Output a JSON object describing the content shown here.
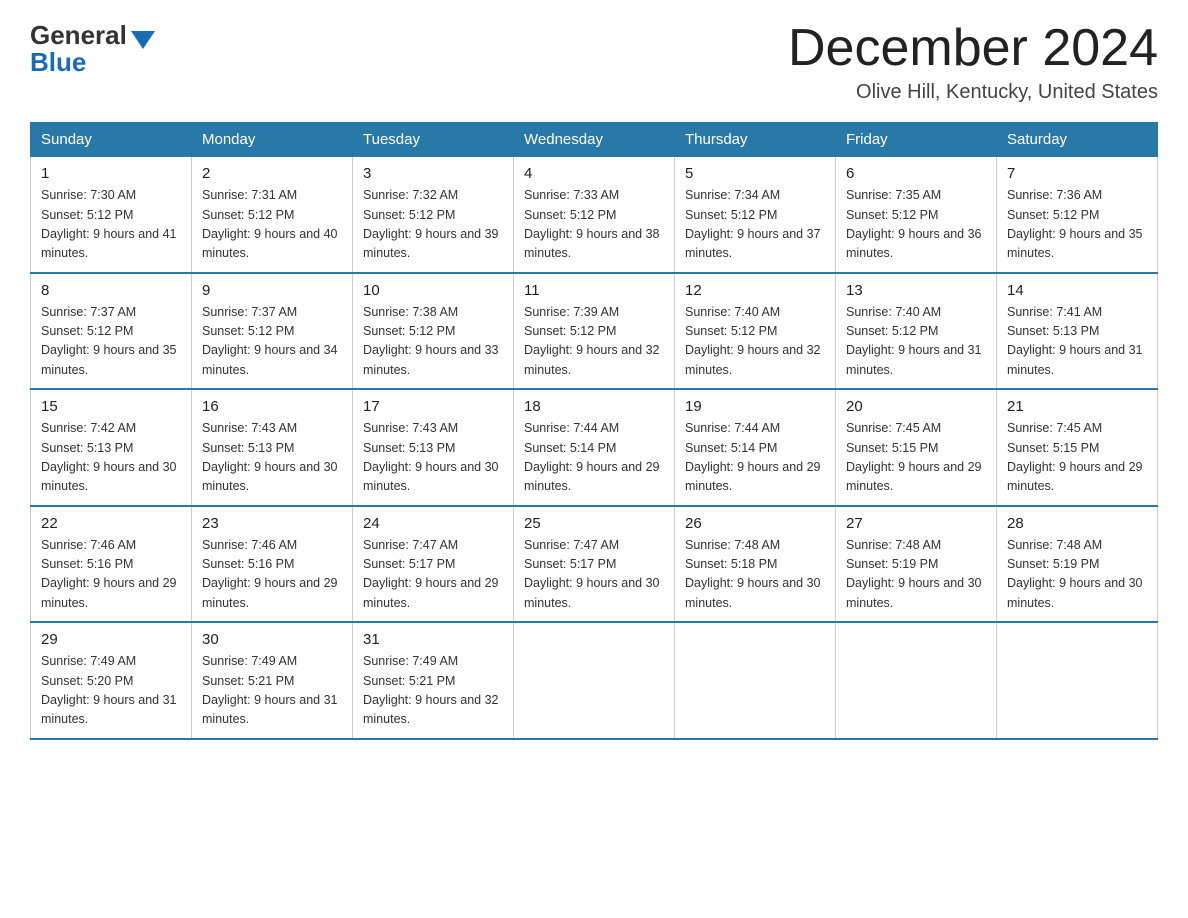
{
  "logo": {
    "general": "General",
    "blue": "Blue"
  },
  "title": "December 2024",
  "location": "Olive Hill, Kentucky, United States",
  "days_of_week": [
    "Sunday",
    "Monday",
    "Tuesday",
    "Wednesday",
    "Thursday",
    "Friday",
    "Saturday"
  ],
  "weeks": [
    [
      {
        "day": "1",
        "sunrise": "7:30 AM",
        "sunset": "5:12 PM",
        "daylight": "9 hours and 41 minutes."
      },
      {
        "day": "2",
        "sunrise": "7:31 AM",
        "sunset": "5:12 PM",
        "daylight": "9 hours and 40 minutes."
      },
      {
        "day": "3",
        "sunrise": "7:32 AM",
        "sunset": "5:12 PM",
        "daylight": "9 hours and 39 minutes."
      },
      {
        "day": "4",
        "sunrise": "7:33 AM",
        "sunset": "5:12 PM",
        "daylight": "9 hours and 38 minutes."
      },
      {
        "day": "5",
        "sunrise": "7:34 AM",
        "sunset": "5:12 PM",
        "daylight": "9 hours and 37 minutes."
      },
      {
        "day": "6",
        "sunrise": "7:35 AM",
        "sunset": "5:12 PM",
        "daylight": "9 hours and 36 minutes."
      },
      {
        "day": "7",
        "sunrise": "7:36 AM",
        "sunset": "5:12 PM",
        "daylight": "9 hours and 35 minutes."
      }
    ],
    [
      {
        "day": "8",
        "sunrise": "7:37 AM",
        "sunset": "5:12 PM",
        "daylight": "9 hours and 35 minutes."
      },
      {
        "day": "9",
        "sunrise": "7:37 AM",
        "sunset": "5:12 PM",
        "daylight": "9 hours and 34 minutes."
      },
      {
        "day": "10",
        "sunrise": "7:38 AM",
        "sunset": "5:12 PM",
        "daylight": "9 hours and 33 minutes."
      },
      {
        "day": "11",
        "sunrise": "7:39 AM",
        "sunset": "5:12 PM",
        "daylight": "9 hours and 32 minutes."
      },
      {
        "day": "12",
        "sunrise": "7:40 AM",
        "sunset": "5:12 PM",
        "daylight": "9 hours and 32 minutes."
      },
      {
        "day": "13",
        "sunrise": "7:40 AM",
        "sunset": "5:12 PM",
        "daylight": "9 hours and 31 minutes."
      },
      {
        "day": "14",
        "sunrise": "7:41 AM",
        "sunset": "5:13 PM",
        "daylight": "9 hours and 31 minutes."
      }
    ],
    [
      {
        "day": "15",
        "sunrise": "7:42 AM",
        "sunset": "5:13 PM",
        "daylight": "9 hours and 30 minutes."
      },
      {
        "day": "16",
        "sunrise": "7:43 AM",
        "sunset": "5:13 PM",
        "daylight": "9 hours and 30 minutes."
      },
      {
        "day": "17",
        "sunrise": "7:43 AM",
        "sunset": "5:13 PM",
        "daylight": "9 hours and 30 minutes."
      },
      {
        "day": "18",
        "sunrise": "7:44 AM",
        "sunset": "5:14 PM",
        "daylight": "9 hours and 29 minutes."
      },
      {
        "day": "19",
        "sunrise": "7:44 AM",
        "sunset": "5:14 PM",
        "daylight": "9 hours and 29 minutes."
      },
      {
        "day": "20",
        "sunrise": "7:45 AM",
        "sunset": "5:15 PM",
        "daylight": "9 hours and 29 minutes."
      },
      {
        "day": "21",
        "sunrise": "7:45 AM",
        "sunset": "5:15 PM",
        "daylight": "9 hours and 29 minutes."
      }
    ],
    [
      {
        "day": "22",
        "sunrise": "7:46 AM",
        "sunset": "5:16 PM",
        "daylight": "9 hours and 29 minutes."
      },
      {
        "day": "23",
        "sunrise": "7:46 AM",
        "sunset": "5:16 PM",
        "daylight": "9 hours and 29 minutes."
      },
      {
        "day": "24",
        "sunrise": "7:47 AM",
        "sunset": "5:17 PM",
        "daylight": "9 hours and 29 minutes."
      },
      {
        "day": "25",
        "sunrise": "7:47 AM",
        "sunset": "5:17 PM",
        "daylight": "9 hours and 30 minutes."
      },
      {
        "day": "26",
        "sunrise": "7:48 AM",
        "sunset": "5:18 PM",
        "daylight": "9 hours and 30 minutes."
      },
      {
        "day": "27",
        "sunrise": "7:48 AM",
        "sunset": "5:19 PM",
        "daylight": "9 hours and 30 minutes."
      },
      {
        "day": "28",
        "sunrise": "7:48 AM",
        "sunset": "5:19 PM",
        "daylight": "9 hours and 30 minutes."
      }
    ],
    [
      {
        "day": "29",
        "sunrise": "7:49 AM",
        "sunset": "5:20 PM",
        "daylight": "9 hours and 31 minutes."
      },
      {
        "day": "30",
        "sunrise": "7:49 AM",
        "sunset": "5:21 PM",
        "daylight": "9 hours and 31 minutes."
      },
      {
        "day": "31",
        "sunrise": "7:49 AM",
        "sunset": "5:21 PM",
        "daylight": "9 hours and 32 minutes."
      },
      null,
      null,
      null,
      null
    ]
  ]
}
